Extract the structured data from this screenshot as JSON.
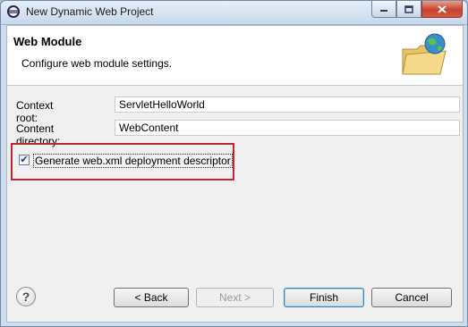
{
  "window": {
    "title": "New Dynamic Web Project"
  },
  "banner": {
    "title": "Web Module",
    "description": "Configure web module settings."
  },
  "form": {
    "context_root": {
      "label": "Context root:",
      "value": "ServletHelloWorld"
    },
    "content_directory": {
      "label": "Content directory:",
      "value": "WebContent"
    },
    "generate_web_xml": {
      "label": "Generate web.xml deployment descriptor",
      "checked": true
    }
  },
  "buttons": {
    "help": "?",
    "back": "< Back",
    "next": "Next >",
    "finish": "Finish",
    "cancel": "Cancel"
  },
  "icons": {
    "app": "eclipse-icon",
    "banner": "folder-globe-icon"
  },
  "colors": {
    "highlight_border": "#c0282d",
    "titlebar": "#c8d8ea"
  }
}
